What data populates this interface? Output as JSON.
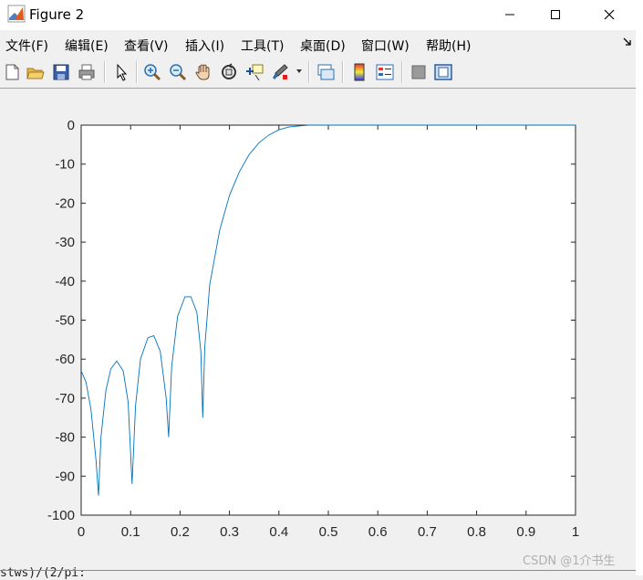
{
  "window": {
    "title": "Figure 2"
  },
  "menu": [
    {
      "label": "文件(F)"
    },
    {
      "label": "编辑(E)"
    },
    {
      "label": "查看(V)"
    },
    {
      "label": "插入(I)"
    },
    {
      "label": "工具(T)"
    },
    {
      "label": "桌面(D)"
    },
    {
      "label": "窗口(W)"
    },
    {
      "label": "帮助(H)"
    }
  ],
  "toolbar": [
    "new-figure-icon",
    "open-file-icon",
    "save-icon",
    "print-icon",
    "pointer-icon",
    "zoom-in-icon",
    "zoom-out-icon",
    "pan-hand-icon",
    "rotate-3d-icon",
    "data-cursor-icon",
    "brush-icon",
    "link-plot-icon",
    "colorbar-icon",
    "legend-icon",
    "hide-plot-tools-icon",
    "show-plot-tools-icon"
  ],
  "chart_data": {
    "type": "line",
    "color": "#0072bd",
    "xlim": [
      0,
      1
    ],
    "ylim": [
      -100,
      0
    ],
    "xticks": [
      "0",
      "0.1",
      "0.2",
      "0.3",
      "0.4",
      "0.5",
      "0.6",
      "0.7",
      "0.8",
      "0.9",
      "1"
    ],
    "yticks": [
      "0",
      "-10",
      "-20",
      "-30",
      "-40",
      "-50",
      "-60",
      "-70",
      "-80",
      "-90",
      "-100"
    ],
    "series": [
      {
        "x": [
          0,
          0.01,
          0.02,
          0.03,
          0.035,
          0.04,
          0.05,
          0.06,
          0.072,
          0.085,
          0.095,
          0.103,
          0.11,
          0.12,
          0.135,
          0.147,
          0.16,
          0.172,
          0.177,
          0.183,
          0.195,
          0.21,
          0.222,
          0.234,
          0.242,
          0.246,
          0.25,
          0.26,
          0.28,
          0.3,
          0.32,
          0.34,
          0.36,
          0.38,
          0.4,
          0.42,
          0.44,
          0.46,
          0.48,
          0.5,
          0.6,
          0.7,
          0.8,
          0.9,
          1.0
        ],
        "y": [
          -63,
          -66,
          -73,
          -86,
          -95,
          -80,
          -68,
          -62.5,
          -60.5,
          -63,
          -71,
          -92,
          -72,
          -60,
          -54.5,
          -54,
          -58,
          -70,
          -80,
          -62,
          -49,
          -44,
          -44,
          -48,
          -58,
          -75,
          -57,
          -41,
          -27,
          -18,
          -12,
          -7.5,
          -4.5,
          -2.5,
          -1.2,
          -0.5,
          -0.2,
          0,
          0,
          0,
          0,
          0,
          0,
          0,
          0
        ]
      }
    ]
  },
  "footer": {
    "cut_text": "stws)/(2/pi:",
    "watermark": "CSDN @1介书生"
  }
}
